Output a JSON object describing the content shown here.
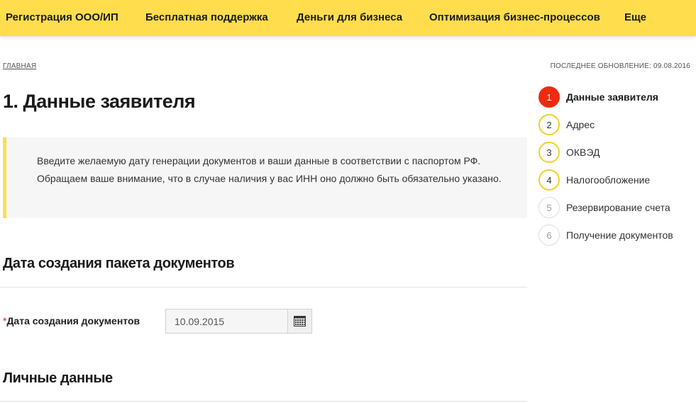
{
  "nav": {
    "items": [
      {
        "label": "Регистрация ООО/ИП"
      },
      {
        "label": "Бесплатная поддержка"
      },
      {
        "label": "Деньги для бизнеса"
      },
      {
        "label": "Оптимизация бизнес-процессов"
      },
      {
        "label": "Еще"
      }
    ]
  },
  "breadcrumb": {
    "home": "ГЛАВНАЯ"
  },
  "last_update": "ПОСЛЕДНЕЕ ОБНОВЛЕНИЕ: 09.08.2016",
  "page_title": "1. Данные заявителя",
  "notice": "Введите желаемую дату генерации документов и ваши данные в соответствии с паспортом РФ. Обращаем ваше внимание, что в случае наличия у вас ИНН оно должно быть обязательно указано.",
  "sections": {
    "package_date_title": "Дата создания пакета документов",
    "personal_title": "Личные данные"
  },
  "date_field": {
    "required_mark": "*",
    "label": "Дата создания документов",
    "value": "10.09.2015",
    "button_icon": "calendar-icon"
  },
  "steps": [
    {
      "number": "1",
      "label": "Данные заявителя",
      "state": "active"
    },
    {
      "number": "2",
      "label": "Адрес",
      "state": "pending"
    },
    {
      "number": "3",
      "label": "ОКВЭД",
      "state": "pending"
    },
    {
      "number": "4",
      "label": "Налогообложение",
      "state": "pending"
    },
    {
      "number": "5",
      "label": "Резервирование счета",
      "state": "disabled"
    },
    {
      "number": "6",
      "label": "Получение документов",
      "state": "disabled"
    }
  ],
  "colors": {
    "nav_bg": "#ffdd4d",
    "active_step": "#ee2a0f",
    "pending_ring": "#f2cf28"
  }
}
